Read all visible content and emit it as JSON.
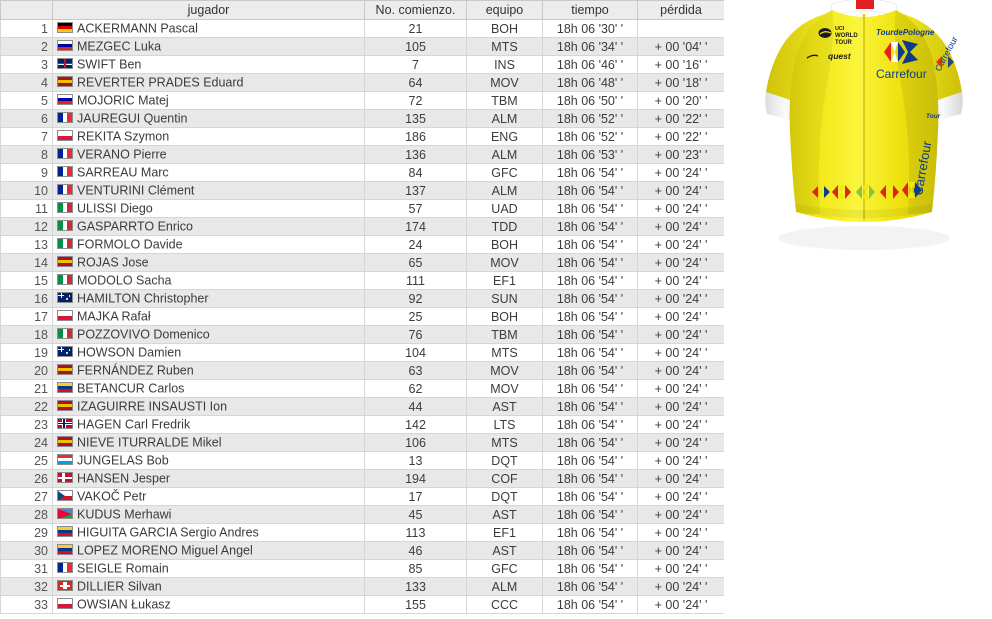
{
  "table": {
    "columns": [
      {
        "key": "rank",
        "label": ""
      },
      {
        "key": "player",
        "label": "jugador"
      },
      {
        "key": "bib",
        "label": "No. comienzo."
      },
      {
        "key": "team",
        "label": "equipo"
      },
      {
        "key": "time",
        "label": "tiempo"
      },
      {
        "key": "gap",
        "label": "pérdida"
      }
    ],
    "rows": [
      {
        "rank": "1",
        "flag": "de",
        "player": "ACKERMANN Pascal",
        "bib": "21",
        "team": "BOH",
        "time": "18h 06 '30' '",
        "gap": ""
      },
      {
        "rank": "2",
        "flag": "si",
        "player": "MEZGEC Luka",
        "bib": "105",
        "team": "MTS",
        "time": "18h 06 '34' '",
        "gap": "+ 00 '04' '"
      },
      {
        "rank": "3",
        "flag": "gb",
        "player": "SWIFT Ben",
        "bib": "7",
        "team": "INS",
        "time": "18h 06 '46' '",
        "gap": "+ 00 '16' '"
      },
      {
        "rank": "4",
        "flag": "es",
        "player": "REVERTER PRADES Eduard",
        "bib": "64",
        "team": "MOV",
        "time": "18h 06 '48' '",
        "gap": "+ 00 '18' '"
      },
      {
        "rank": "5",
        "flag": "si",
        "player": "MOJORIC Matej",
        "bib": "72",
        "team": "TBM",
        "time": "18h 06 '50' '",
        "gap": "+ 00 '20' '"
      },
      {
        "rank": "6",
        "flag": "fr",
        "player": "JAUREGUI Quentin",
        "bib": "135",
        "team": "ALM",
        "time": "18h 06 '52' '",
        "gap": "+ 00 '22' '"
      },
      {
        "rank": "7",
        "flag": "pl",
        "player": "REKITA Szymon",
        "bib": "186",
        "team": "ENG",
        "time": "18h 06 '52' '",
        "gap": "+ 00 '22' '"
      },
      {
        "rank": "8",
        "flag": "fr",
        "player": "VERANO Pierre",
        "bib": "136",
        "team": "ALM",
        "time": "18h 06 '53' '",
        "gap": "+ 00 '23' '"
      },
      {
        "rank": "9",
        "flag": "fr",
        "player": "SARREAU Marc",
        "bib": "84",
        "team": "GFC",
        "time": "18h 06 '54' '",
        "gap": "+ 00 '24' '"
      },
      {
        "rank": "10",
        "flag": "fr",
        "player": "VENTURINI Clément",
        "bib": "137",
        "team": "ALM",
        "time": "18h 06 '54' '",
        "gap": "+ 00 '24' '"
      },
      {
        "rank": "11",
        "flag": "it",
        "player": "ULISSI Diego",
        "bib": "57",
        "team": "UAD",
        "time": "18h 06 '54' '",
        "gap": "+ 00 '24' '"
      },
      {
        "rank": "12",
        "flag": "it",
        "player": "GASPARRTO Enrico",
        "bib": "174",
        "team": "TDD",
        "time": "18h 06 '54' '",
        "gap": "+ 00 '24' '"
      },
      {
        "rank": "13",
        "flag": "it",
        "player": "FORMOLO Davide",
        "bib": "24",
        "team": "BOH",
        "time": "18h 06 '54' '",
        "gap": "+ 00 '24' '"
      },
      {
        "rank": "14",
        "flag": "es",
        "player": "ROJAS Jose",
        "bib": "65",
        "team": "MOV",
        "time": "18h 06 '54' '",
        "gap": "+ 00 '24' '"
      },
      {
        "rank": "15",
        "flag": "it",
        "player": "MODOLO Sacha",
        "bib": "111",
        "team": "EF1",
        "time": "18h 06 '54' '",
        "gap": "+ 00 '24' '"
      },
      {
        "rank": "16",
        "flag": "au",
        "player": "HAMILTON Christopher",
        "bib": "92",
        "team": "SUN",
        "time": "18h 06 '54' '",
        "gap": "+ 00 '24' '"
      },
      {
        "rank": "17",
        "flag": "pl",
        "player": "MAJKA Rafał",
        "bib": "25",
        "team": "BOH",
        "time": "18h 06 '54' '",
        "gap": "+ 00 '24' '"
      },
      {
        "rank": "18",
        "flag": "it",
        "player": "POZZOVIVO Domenico",
        "bib": "76",
        "team": "TBM",
        "time": "18h 06 '54' '",
        "gap": "+ 00 '24' '"
      },
      {
        "rank": "19",
        "flag": "au",
        "player": "HOWSON Damien",
        "bib": "104",
        "team": "MTS",
        "time": "18h 06 '54' '",
        "gap": "+ 00 '24' '"
      },
      {
        "rank": "20",
        "flag": "es",
        "player": "FERNÁNDEZ Ruben",
        "bib": "63",
        "team": "MOV",
        "time": "18h 06 '54' '",
        "gap": "+ 00 '24' '"
      },
      {
        "rank": "21",
        "flag": "co",
        "player": "BETANCUR Carlos",
        "bib": "62",
        "team": "MOV",
        "time": "18h 06 '54' '",
        "gap": "+ 00 '24' '"
      },
      {
        "rank": "22",
        "flag": "es",
        "player": "IZAGUIRRE INSAUSTI Ion",
        "bib": "44",
        "team": "AST",
        "time": "18h 06 '54' '",
        "gap": "+ 00 '24' '"
      },
      {
        "rank": "23",
        "flag": "no",
        "player": "HAGEN Carl Fredrik",
        "bib": "142",
        "team": "LTS",
        "time": "18h 06 '54' '",
        "gap": "+ 00 '24' '"
      },
      {
        "rank": "24",
        "flag": "es",
        "player": "NIEVE ITURRALDE Mikel",
        "bib": "106",
        "team": "MTS",
        "time": "18h 06 '54' '",
        "gap": "+ 00 '24' '"
      },
      {
        "rank": "25",
        "flag": "lu",
        "player": "JUNGELAS Bob",
        "bib": "13",
        "team": "DQT",
        "time": "18h 06 '54' '",
        "gap": "+ 00 '24' '"
      },
      {
        "rank": "26",
        "flag": "dk",
        "player": "HANSEN Jesper",
        "bib": "194",
        "team": "COF",
        "time": "18h 06 '54' '",
        "gap": "+ 00 '24' '"
      },
      {
        "rank": "27",
        "flag": "cz",
        "player": "VAKOČ Petr",
        "bib": "17",
        "team": "DQT",
        "time": "18h 06 '54' '",
        "gap": "+ 00 '24' '"
      },
      {
        "rank": "28",
        "flag": "er",
        "player": "KUDUS Merhawi",
        "bib": "45",
        "team": "AST",
        "time": "18h 06 '54' '",
        "gap": "+ 00 '24' '"
      },
      {
        "rank": "29",
        "flag": "co",
        "player": "HIGUITA GARCIA Sergio Andres",
        "bib": "113",
        "team": "EF1",
        "time": "18h 06 '54' '",
        "gap": "+ 00 '24' '"
      },
      {
        "rank": "30",
        "flag": "co",
        "player": "LOPEZ MORENO Miguel Angel",
        "bib": "46",
        "team": "AST",
        "time": "18h 06 '54' '",
        "gap": "+ 00 '24' '"
      },
      {
        "rank": "31",
        "flag": "fr",
        "player": "SEIGLE Romain",
        "bib": "85",
        "team": "GFC",
        "time": "18h 06 '54' '",
        "gap": "+ 00 '24' '"
      },
      {
        "rank": "32",
        "flag": "ch",
        "player": "DILLIER Silvan",
        "bib": "133",
        "team": "ALM",
        "time": "18h 06 '54' '",
        "gap": "+ 00 '24' '"
      },
      {
        "rank": "33",
        "flag": "pl",
        "player": "OWSIAN Łukasz",
        "bib": "155",
        "team": "CCC",
        "time": "18h 06 '54' '",
        "gap": "+ 00 '24' '"
      }
    ]
  },
  "jersey": {
    "type": "leader-jersey",
    "body_color": "#f2e814",
    "cuff_color": "#f4f4f4",
    "sponsor_main": "Carrefour",
    "sponsor_team": "TourdePologne",
    "badge_uci": "UCI WORLD TOUR",
    "badge_quest": "quest",
    "sleeve_text": "Carrefour",
    "side_text": "Carrefour",
    "hem_logo_colors": [
      "#e2231a",
      "#e2231a",
      "#8cc63f",
      "#e2231a"
    ]
  }
}
